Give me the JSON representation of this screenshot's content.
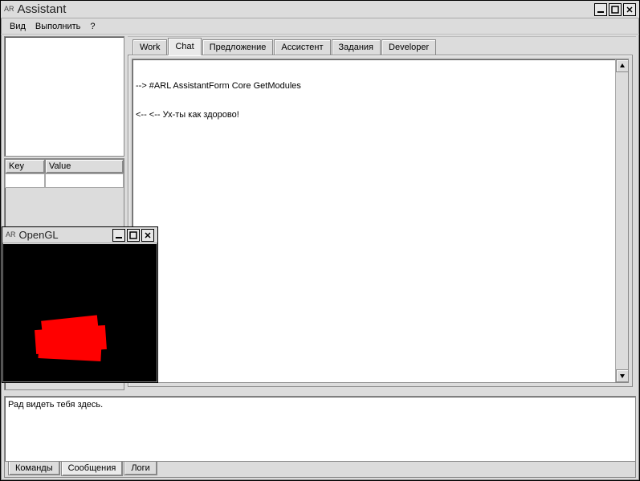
{
  "main_window": {
    "badge": "AR",
    "title": "Assistant",
    "menu": {
      "view": "Вид",
      "execute": "Выполнить",
      "help": "?"
    },
    "kv": {
      "key_header": "Key",
      "value_header": "Value"
    },
    "tabs": {
      "work": "Work",
      "chat": "Chat",
      "offer": "Предложение",
      "assistant": "Ассистент",
      "tasks": "Задания",
      "developer": "Developer"
    },
    "chat": {
      "line1": "--> #ARL AssistantForm Core GetModules",
      "line2": "<-- <-- Ух-ты как здорово!"
    },
    "bottom": {
      "message": "Рад видеть тебя здесь.",
      "tabs": {
        "commands": "Команды",
        "messages": "Сообщения",
        "logs": "Логи"
      }
    }
  },
  "gl_window": {
    "badge": "AR",
    "title": "OpenGL"
  }
}
